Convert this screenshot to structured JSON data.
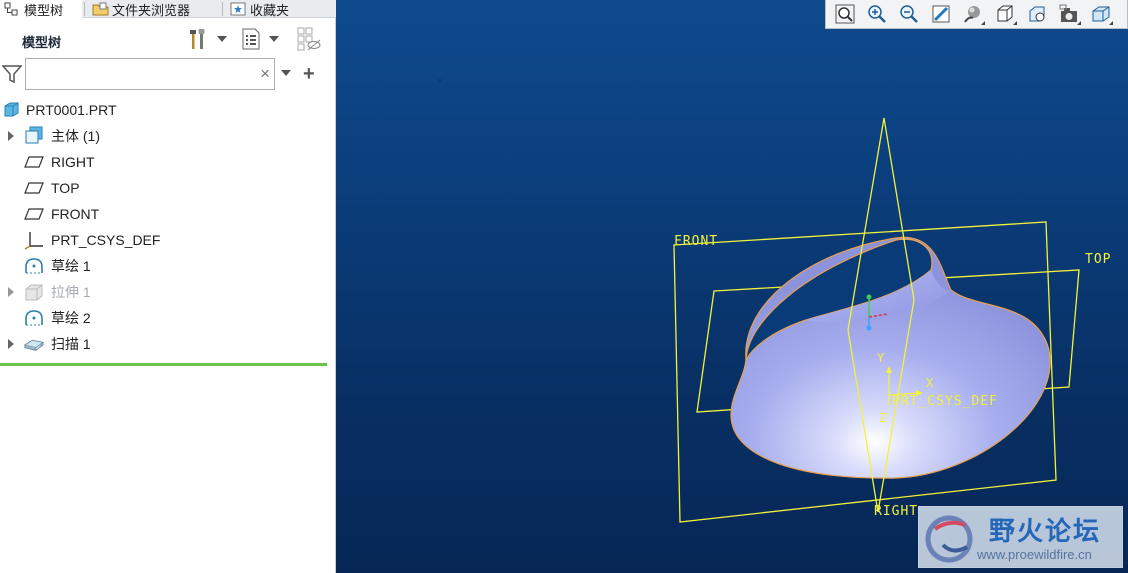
{
  "tabs": [
    {
      "label": "模型树",
      "active": true
    },
    {
      "label": "文件夹浏览器",
      "active": false
    },
    {
      "label": "收藏夹",
      "active": false
    }
  ],
  "tree_panel": {
    "title": "模型树",
    "search_placeholder": "",
    "search_value": "",
    "clear_glyph": "×",
    "add_glyph": "+"
  },
  "tree_items": [
    {
      "label": "PRT0001.PRT",
      "icon": "part-icon",
      "expandable": false,
      "dimmed": false
    },
    {
      "label": "主体 (1)",
      "icon": "body-icon",
      "expandable": true,
      "dimmed": false
    },
    {
      "label": "RIGHT",
      "icon": "datum-plane-icon",
      "expandable": false,
      "dimmed": false
    },
    {
      "label": "TOP",
      "icon": "datum-plane-icon",
      "expandable": false,
      "dimmed": false
    },
    {
      "label": "FRONT",
      "icon": "datum-plane-icon",
      "expandable": false,
      "dimmed": false
    },
    {
      "label": "PRT_CSYS_DEF",
      "icon": "csys-icon",
      "expandable": false,
      "dimmed": false
    },
    {
      "label": "草绘 1",
      "icon": "sketch-icon",
      "expandable": false,
      "dimmed": false
    },
    {
      "label": "拉伸 1",
      "icon": "extrude-icon",
      "expandable": true,
      "dimmed": true
    },
    {
      "label": "草绘 2",
      "icon": "sketch-icon",
      "expandable": false,
      "dimmed": false
    },
    {
      "label": "扫描 1",
      "icon": "sweep-icon",
      "expandable": true,
      "dimmed": false
    }
  ],
  "view_toolbar": [
    "zoom-fit-icon",
    "zoom-in-icon",
    "zoom-out-icon",
    "repaint-icon",
    "display-style-icon",
    "saved-orientations-icon",
    "view-manager-icon",
    "datum-display-icon",
    "spin-center-icon"
  ],
  "datum_labels": {
    "front": "FRONT",
    "top": "TOP",
    "right": "RIGHT",
    "csys": "PRT_CSYS_DEF",
    "axis_x": "X",
    "axis_y": "Y",
    "axis_z": "Z"
  },
  "colors": {
    "datum_plane": "#f2f23a",
    "surface": "#a9b0ef",
    "surface_edge": "#e8a050",
    "tree_accent": "#6cc24a"
  },
  "watermark": {
    "title": "野火论坛",
    "url": "www.proewildfire.cn"
  }
}
